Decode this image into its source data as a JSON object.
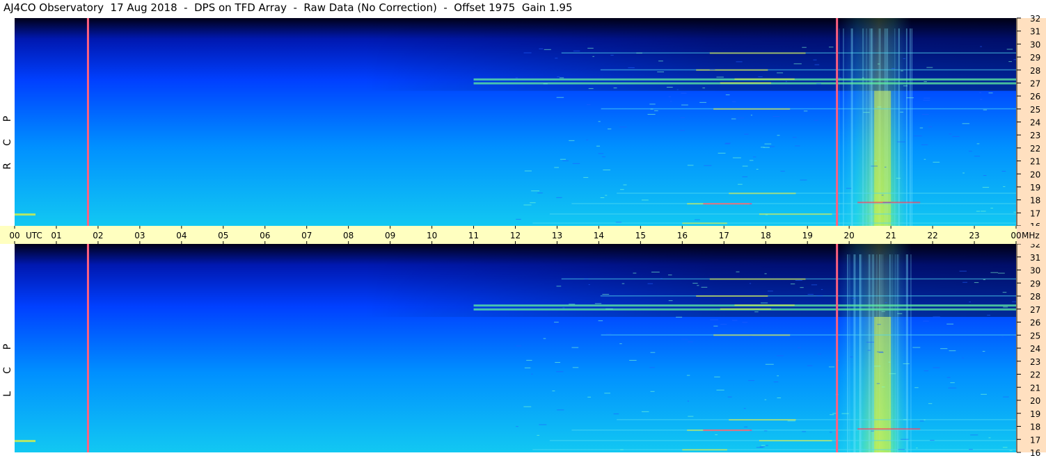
{
  "header": {
    "title": "AJ4CO Observatory  17 Aug 2018  -  DPS on TFD Array  -  Raw Data (No Correction)  -  Offset 1975  Gain 1.95"
  },
  "colors": {
    "time_bar": "#ffffc0",
    "freq_axis": "#ffe0c0",
    "sky_low": "#10c0f0",
    "sky_high": "#000018",
    "marker_line": "#ff6080"
  },
  "chart_data": {
    "type": "heatmap",
    "title": "AJ4CO Observatory  17 Aug 2018  -  DPS on TFD Array  -  Raw Data (No Correction)  -  Offset 1975  Gain 1.95",
    "x_label": "UTC",
    "x_tick_labels": [
      "00",
      "01",
      "02",
      "03",
      "04",
      "05",
      "06",
      "07",
      "08",
      "09",
      "10",
      "11",
      "12",
      "13",
      "14",
      "15",
      "16",
      "17",
      "18",
      "19",
      "20",
      "21",
      "22",
      "23",
      "00"
    ],
    "x_range_hours": [
      0,
      24
    ],
    "y_unit": "MHz",
    "y_range_mhz": [
      16,
      32
    ],
    "y_tick_labels": [
      "16",
      "17",
      "18",
      "19",
      "20",
      "21",
      "22",
      "23",
      "24",
      "25",
      "26",
      "27",
      "28",
      "29",
      "30",
      "31",
      "32"
    ],
    "panels": [
      {
        "name": "R C P",
        "letters": [
          "R",
          "C",
          "P"
        ]
      },
      {
        "name": "L C P",
        "letters": [
          "L",
          "C",
          "P"
        ]
      }
    ],
    "markers_utc_hours": [
      1.75,
      19.7
    ],
    "bright_band_utc_hours": [
      19.75,
      21.5
    ],
    "bright_peak_utc_hour": 20.8,
    "interference_lines_mhz": [
      16.2,
      16.9,
      17.7,
      18.5,
      25.0,
      27.0,
      27.3,
      28.0,
      29.3
    ],
    "grid": false
  }
}
